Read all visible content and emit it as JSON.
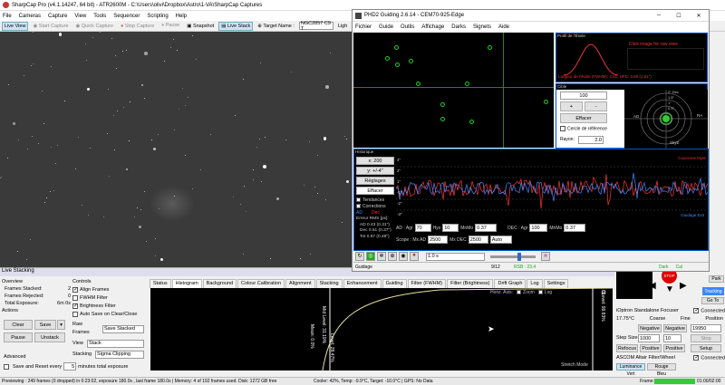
{
  "sharpcap": {
    "title": "SharpCap Pro (v4.1.14247, 64 bit) - ATR2600M - C:\\Users\\olivi\\Dropbox\\Astro\\1-VA\\SharpCap Captures",
    "menu": [
      "File",
      "Cameras",
      "Capture",
      "View",
      "Tools",
      "Sequencer",
      "Scripting",
      "Help"
    ],
    "toolbar": {
      "live_view": "Live View",
      "start_capture": "Start Capture",
      "quick_capture": "Quick Capture",
      "stop_capture": "Stop Capture",
      "pause": "Pause",
      "snapshot": "Snapshot",
      "live_stack": "Live Stack",
      "target_label": "Target Name :",
      "target_value": "NGC2857 C9 T",
      "light": "Ligh"
    },
    "live_stacking": {
      "title": "Live Stacking",
      "overview_label": "Overview",
      "frames_stacked_label": "Frames Stacked:",
      "frames_stacked": "2",
      "frames_rejected_label": "Frames Rejected:",
      "frames_rejected": "0",
      "total_exposure_label": "Total Exposure:",
      "total_exposure": "6m 0s",
      "actions_label": "Actions",
      "clear": "Clear",
      "save": "Save",
      "pause": "Pause",
      "unstack": "Unstack",
      "advanced_label": "Advanced",
      "save_reset_label": "Save and Reset every",
      "save_reset_value": "5",
      "save_reset_suffix": "minutes total exposure",
      "controls_label": "Controls",
      "align_frames": "Align Frames",
      "fwhm_filter": "FWHM Filter",
      "brightness_filter": "Brightness Filter",
      "auto_save": "Auto Save on Clear/Close",
      "raw_frames_label": "Raw Frames",
      "raw_frames_value": "Save Stacked",
      "view_label": "View",
      "view_value": "Stack",
      "stacking_label": "Stacking",
      "stacking_value": "Sigma Clipping",
      "tabs": [
        "Status",
        "Histogram",
        "Background",
        "Colour Calibration",
        "Alignment",
        "Stacking",
        "Enhancement",
        "Guiding",
        "Filter (FWHM)",
        "Filter (Brightness)",
        "Drift Graph",
        "Log",
        "Settings"
      ],
      "hist_horiz": "Horiz. Axis:",
      "hist_zoom": "Zoom",
      "hist_log": "Log",
      "hist_mean": "Mean: 0.0%",
      "hist_level_right": "Level: 99.83%",
      "hist_stretch": "Stretch Mode",
      "hist_left1": "Mid Level: 31.19%",
      "hist_left2": "Level: 28.47%"
    },
    "status_bar": "Previewing : 249 frames (0 dropped) in 0:23:02, exposure 180.0s , last frame 180.0s | Memory: 4 of 192 frames used. Disk: 1272 GB free",
    "status_bar_right": "Cooler: 42%, Temp: -9.9°C, Target: -10.0°C | GPS: No Data",
    "status_frame": "Frame:",
    "status_time": "01:00/02:00"
  },
  "phd": {
    "title": "PHD2 Guiding 2.6.14 - CEM70-925-Edge",
    "menu": [
      "Fichier",
      "Guide",
      "Outils",
      "Affichage",
      "Darks",
      "Signets",
      "Aide"
    ],
    "profile_title": "Profil de l'Étoile",
    "profile_click": "Click image for raw view",
    "profile_stats": "Largeur de l'étoile (FWHM): 4.61, HFD: 3.69 (2.81\")",
    "target_title": "Cible",
    "target_value": "100",
    "target_plus": "+",
    "target_minus": "-",
    "target_clear": "Effacer",
    "target_circle": "Cercle de référence",
    "target_radius_label": "Rayon:",
    "target_radius": "2.0",
    "target_rings": [
      "2\" Dec",
      "1.5\"",
      "1\"",
      "0.5\""
    ],
    "target_ad": "AD",
    "target_ra_axis": "RA",
    "target_skyl": "SkyE",
    "history_title": "Historique",
    "x_btn": "x: 200",
    "y_btn": "y: +/-4\"",
    "settings_btn": "Réglages",
    "clear_btn": "Effacer",
    "trends": "Tendances",
    "corrections": "Corrections",
    "legend_ad": "AD",
    "legend_dec": "Dec",
    "rms_title": "Erreur RMS [px]:",
    "rms_ad": "AD 0.43 (0.31\")",
    "rms_dec": "Dec 0.51 (0.37\")",
    "rms_tot": "Tot 0.67 (0.48\")",
    "graph_labels_left": [
      "4\"",
      "2\"",
      "1\"",
      "-1\"",
      "-2\"",
      "-3\""
    ],
    "guide_exit": "Guidage Exit",
    "range_right": "Couronne triple",
    "ad_aggr_label": "AD : Agr",
    "ad_aggr": "70",
    "hys_label": "Hys",
    "hys": "10",
    "mnmo_label": "MnMo",
    "mnmo": "0.37",
    "dec_aggr_label": "DEC : Agr",
    "dec_aggr": "100",
    "dec_mnmo": "0.37",
    "scope_label": "Scope : Mx AD",
    "mx_ad": "2500",
    "mx_dec_label": "Mx DEC",
    "mx_dec": "2500",
    "auto": "Auto",
    "exposure": "1.0 s",
    "status_guidage": "Guidage",
    "status_snr": "9/12",
    "status_rsb": "RSB : 23.4",
    "status_dark": "Dark",
    "status_cal": "Cal"
  },
  "right_panel": {
    "park": "Park",
    "goto": "Go To",
    "tracking": "Tracking",
    "focuser_title": "iOptron Standalone Focuser",
    "connected": "Connected",
    "temp": "17.75°C",
    "coarse": "Coarse",
    "fine": "Fine",
    "position": "Position",
    "negative": "Negative",
    "positive": "Positive",
    "pos_value": "19950",
    "step_size_label": "Step Size",
    "step_size": "1000",
    "step_fine": "10",
    "stop": "Stop",
    "refocus": "Refocus",
    "setup": "Setup",
    "filterwheel_title": "ASCOM Altair Filter/Wheel",
    "fw_connected": "Connected",
    "luminance": "Luminance",
    "rouge": "Rouge",
    "vert": "Vert",
    "bleu": "Bleu",
    "stop_label": "STOP"
  },
  "colors": {
    "accent": "#cce4f7",
    "phd_red": "#ff3333",
    "phd_blue": "#4488ff",
    "guide_green": "#33cc33"
  }
}
